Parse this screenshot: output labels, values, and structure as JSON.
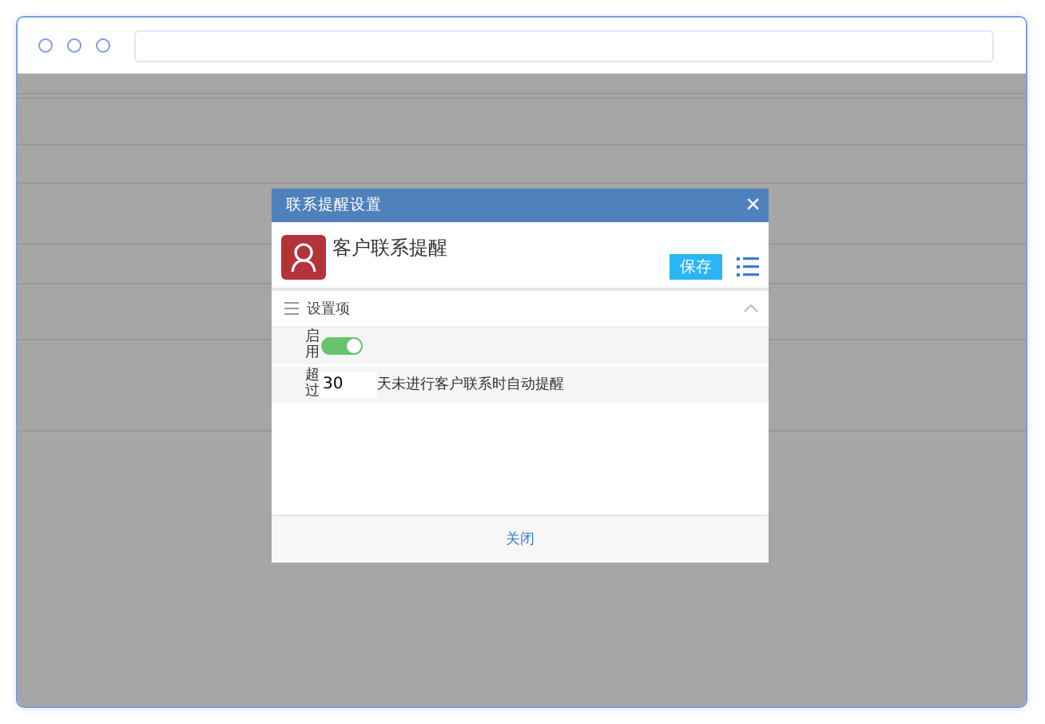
{
  "dialog": {
    "title": "联系提醒设置",
    "close": "×",
    "heading": "客户联系提醒",
    "save_button": "保存",
    "section": {
      "title": "设置项",
      "expanded": true,
      "rows": [
        {
          "kind": "toggle",
          "label": "启用",
          "on": true
        },
        {
          "kind": "number",
          "label": "超过",
          "value": "30",
          "suffix": "天未进行客户联系时自动提醒"
        }
      ]
    },
    "footer_button": "关闭"
  }
}
